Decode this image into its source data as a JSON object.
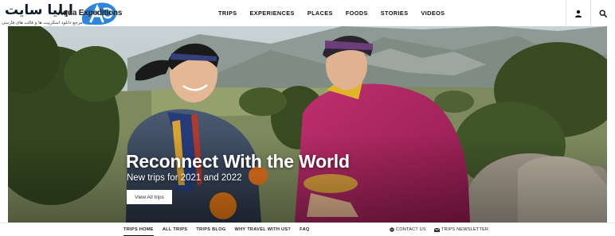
{
  "logo": {
    "title_arabic": "ایلیا سایت",
    "subtitle_arabic": "مرجع دانلود اسکریپت ها و قالب های فارسی",
    "overlay_text": "Aqua Expeditions"
  },
  "header": {
    "nav": [
      "TRIPS",
      "EXPERIENCES",
      "PLACES",
      "FOODS",
      "STORIES",
      "VIDEOS"
    ],
    "icons": [
      "user-icon",
      "search-icon"
    ]
  },
  "hero": {
    "title": "Reconnect With the World",
    "subtitle": "New trips for 2021 and 2022",
    "button_label": "View All trips"
  },
  "subnav": {
    "left": [
      "TRIPS HOME",
      "ALL TRIPS",
      "TRIPS BLOG",
      "WHY TRAVEL WITH US?",
      "FAQ"
    ],
    "active_index": 0,
    "right": [
      {
        "label": "CONTACT US",
        "icon": "chat-icon"
      },
      {
        "label": "TRIPS NEWSLETTER",
        "icon": "mail-icon"
      }
    ]
  },
  "colors": {
    "brand_blue": "#2f86d8",
    "header_text": "#111111",
    "hero_text": "#ffffff"
  }
}
